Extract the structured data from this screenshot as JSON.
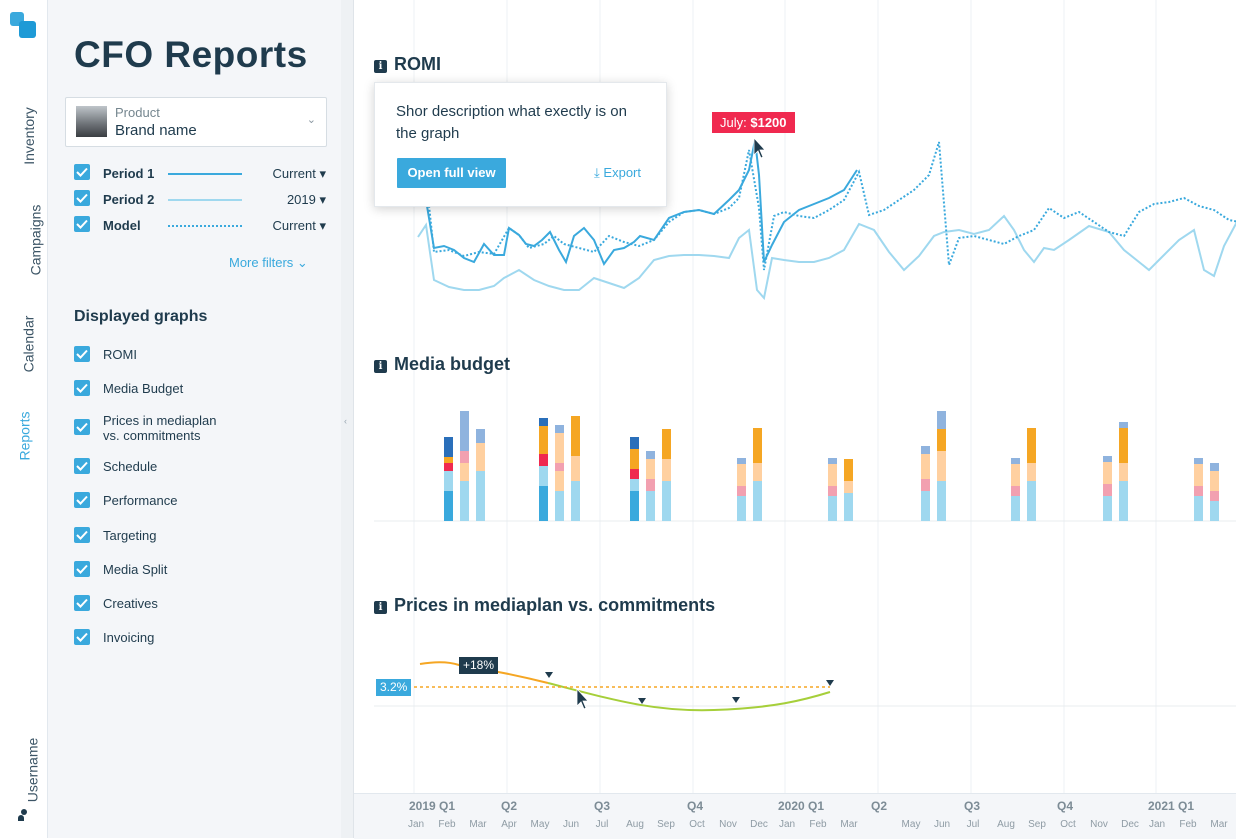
{
  "rail": {
    "items": [
      "Inventory",
      "Campaigns",
      "Calendar",
      "Reports"
    ],
    "active": "Reports",
    "username": "Username"
  },
  "sidebar": {
    "title": "CFO Reports",
    "product": {
      "label": "Product",
      "value": "Brand name"
    },
    "periods": [
      {
        "name": "Period 1",
        "value": "Current",
        "line": "solid"
      },
      {
        "name": "Period 2",
        "value": "2019",
        "line": "light"
      },
      {
        "name": "Model",
        "value": "Current",
        "line": "dotted"
      }
    ],
    "more_filters": "More filters",
    "graphs_title": "Displayed graphs",
    "graphs": [
      "ROMI",
      "Media Budget",
      "Prices in mediaplan vs. commitments",
      "Schedule",
      "Performance",
      "Targeting",
      "Media Split",
      "Creatives",
      "Invoicing"
    ]
  },
  "main": {
    "romi": {
      "title": "ROMI",
      "tooltip": {
        "description": "Shor description what exectly is on the graph",
        "open_label": "Open full view",
        "export_label": "Export"
      },
      "flag_label": "July:",
      "flag_value": "$1200"
    },
    "media_budget": {
      "title": "Media budget"
    },
    "prices": {
      "title": "Prices in mediaplan vs. commitments",
      "baseline_label": "3.2%",
      "change_label": "+18%"
    },
    "timeline": {
      "quarters": [
        "2019 Q1",
        "Q2",
        "Q3",
        "Q4",
        "2020 Q1",
        "Q2",
        "Q3",
        "Q4",
        "2021 Q1"
      ],
      "months": [
        "Jan",
        "Feb",
        "Mar",
        "Apr",
        "May",
        "Jun",
        "Jul",
        "Aug",
        "Sep",
        "Oct",
        "Nov",
        "Dec",
        "Jan",
        "Feb",
        "Mar",
        "May",
        "Jun",
        "Jul",
        "Aug",
        "Sep",
        "Oct",
        "Nov",
        "Dec",
        "Jan",
        "Feb",
        "Mar"
      ]
    }
  },
  "colors": {
    "accent": "#3aa9dd",
    "dark": "#1f3b4d",
    "flag": "#f0294f",
    "orange": "#f5a623",
    "green": "#8cc63f"
  }
}
